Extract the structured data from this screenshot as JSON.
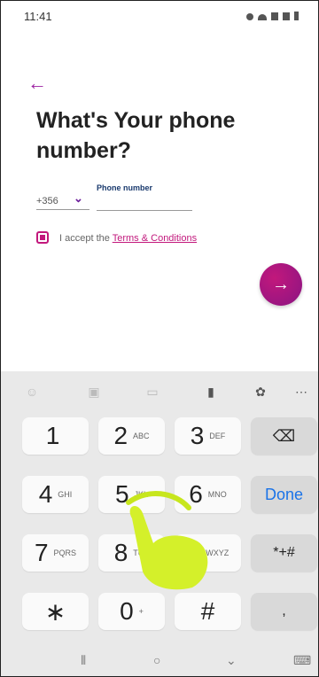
{
  "status": {
    "time": "11:41"
  },
  "form": {
    "title": "What's Your phone number?",
    "country_code": "+356",
    "phone_label": "Phone number",
    "phone_value": "",
    "terms_prefix": "I accept the ",
    "terms_link": "Terms & Conditions"
  },
  "keyboard": {
    "toolbar_icons": [
      "emoji-icon",
      "sticker-icon",
      "gif-icon",
      "microphone-icon",
      "settings-icon",
      "more-icon"
    ],
    "rows": [
      [
        {
          "n": "1",
          "s": ""
        },
        {
          "n": "2",
          "s": "ABC"
        },
        {
          "n": "3",
          "s": "DEF"
        },
        {
          "n": "⌫",
          "s": "",
          "special": true
        }
      ],
      [
        {
          "n": "4",
          "s": "GHI"
        },
        {
          "n": "5",
          "s": "JKL"
        },
        {
          "n": "6",
          "s": "MNO"
        },
        {
          "n": "Done",
          "s": "",
          "special": true
        }
      ],
      [
        {
          "n": "7",
          "s": "PQRS"
        },
        {
          "n": "8",
          "s": "TUV"
        },
        {
          "n": "9",
          "s": "WXYZ"
        },
        {
          "n": "*+#",
          "s": "",
          "special": true
        }
      ],
      [
        {
          "n": "∗",
          "s": ""
        },
        {
          "n": "0",
          "s": "+"
        },
        {
          "n": "#",
          "s": ""
        },
        {
          "n": ",",
          "s": "",
          "special": true
        }
      ]
    ]
  },
  "colors": {
    "accent": "#c2187c",
    "fab": "#9b1fa0"
  }
}
